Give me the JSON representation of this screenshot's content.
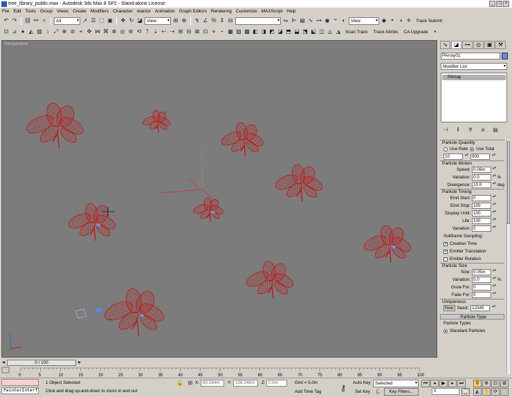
{
  "window": {
    "title": "tree_library_public.max - Autodesk 3ds Max 8 SP2 - Stand-alone License"
  },
  "menu": [
    "File",
    "Edit",
    "Tools",
    "Group",
    "Views",
    "Create",
    "Modifiers",
    "Character",
    "reactor",
    "Animation",
    "Graph Editors",
    "Rendering",
    "Customize",
    "MAXScript",
    "Help"
  ],
  "toolbar1": {
    "selection_filter": "All",
    "ref_coord": "View",
    "named_sel": "",
    "view_select": "View",
    "track_submit": "Track Submit"
  },
  "toolbar2": {
    "scan_track": "Scan Track",
    "track_attribs": "Track Attribs",
    "ca_upgrade": "CA Upgrade"
  },
  "viewport": {
    "label": "Perspective",
    "bg": "#7c7c7c",
    "wire_color": "#c01818"
  },
  "command_panel": {
    "object_name": "PArray01",
    "object_color": "#6a8cd0",
    "modifier_list": "Modifier List",
    "stack": [
      "PArray"
    ],
    "particle_quantity": {
      "header": "Particle Quantity",
      "use_rate": "Use Rate",
      "use_total": "Use Total",
      "rate": "10",
      "total": "900"
    },
    "particle_motion": {
      "header": "Particle Motion",
      "speed_label": "Speed:",
      "speed": "0.06m",
      "variation_label": "Variation:",
      "variation": "0.0",
      "variation_unit": "%",
      "divergence_label": "Divergence:",
      "divergence": "10.0",
      "divergence_unit": "deg"
    },
    "particle_timing": {
      "header": "Particle Timing",
      "emit_start_label": "Emit Start:",
      "emit_start": "0",
      "emit_stop_label": "Emit Stop:",
      "emit_stop": "100",
      "display_until_label": "Display Until:",
      "display_until": "100",
      "life_label": "Life:",
      "life": "100",
      "variation_label": "Variation:",
      "variation": "0",
      "subframe": "Subframe Sampling:",
      "creation_time": "Creation Time",
      "emitter_translation": "Emitter Translation",
      "emitter_rotation": "Emitter Rotation"
    },
    "particle_size": {
      "header": "Particle Size",
      "size_label": "Size:",
      "size": "0.05m",
      "variation_label": "Variation:",
      "variation": "0.0",
      "variation_unit": "%",
      "grow_for_label": "Grow For:",
      "grow_for": "0",
      "fade_for_label": "Fade For:",
      "fade_for": "0"
    },
    "uniqueness": {
      "header": "Uniqueness",
      "new_label": "New",
      "seed_label": "Seed:",
      "seed": "12345"
    },
    "particle_type": {
      "header": "Particle Type",
      "types_label": "Particle Types",
      "standard": "Standard Particles"
    }
  },
  "timeline": {
    "slider_label": "0 / 100",
    "ticks": [
      "0",
      "5",
      "10",
      "15",
      "20",
      "25",
      "30",
      "35",
      "40",
      "45",
      "50",
      "55",
      "60",
      "65",
      "70",
      "75",
      "80",
      "85",
      "90",
      "95",
      "100"
    ]
  },
  "status": {
    "maxscript": "PainterInterf",
    "selected": "1 Object Selected",
    "prompt": "Click and drag up-and-down to zoom in and out",
    "x_label": "X:",
    "x": "60.164m",
    "y_label": "Y:",
    "y": "108.348m",
    "z_label": "Z:",
    "z": "0.0m",
    "grid": "Grid = 5.0m",
    "add_time_tag": "Add Time Tag",
    "auto_key": "Auto Key",
    "set_key": "Set Key",
    "key_mode": "Selected",
    "key_filters": "Key Filters...",
    "frame": "0"
  }
}
